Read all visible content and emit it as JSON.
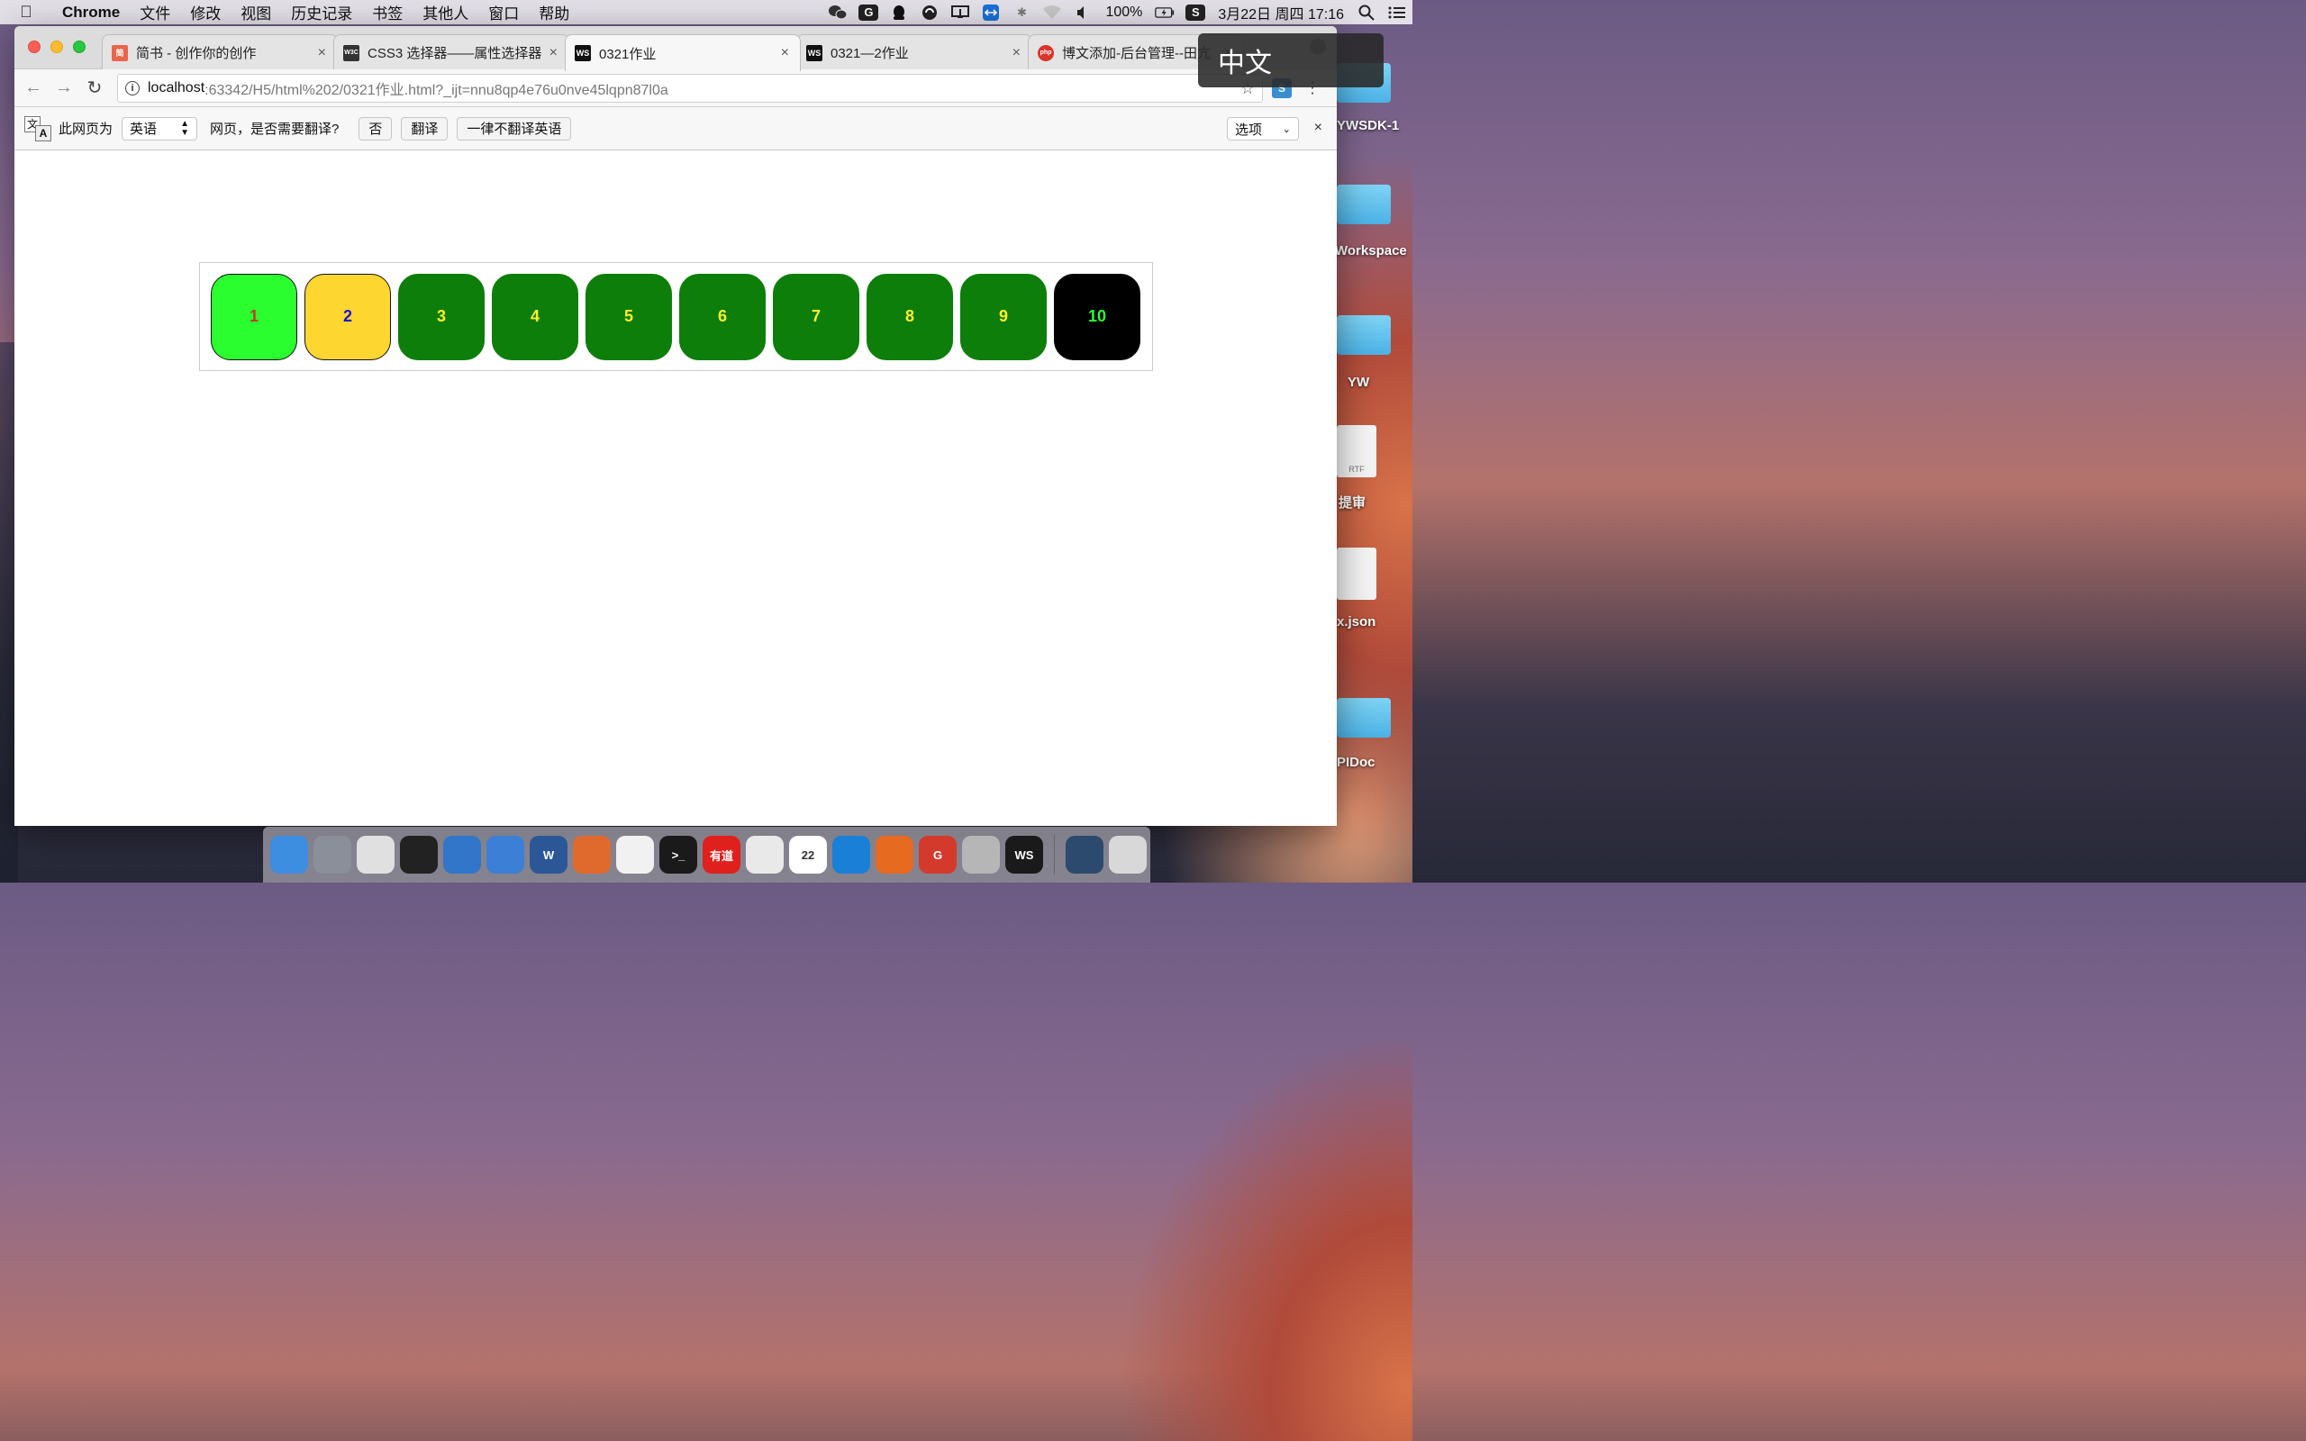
{
  "menubar": {
    "app_name": "Chrome",
    "items": [
      "文件",
      "修改",
      "视图",
      "历史记录",
      "书签",
      "其他人",
      "窗口",
      "帮助"
    ],
    "battery": "100%",
    "clock": "3月22日 周四  17:16"
  },
  "ime_badge": "中文",
  "tabs": [
    {
      "title": "简书 - 创作你的创作",
      "favicon": "简",
      "favicon_color": "#e9654b",
      "close": "×"
    },
    {
      "title": "CSS3 选择器——属性选择器",
      "favicon": "W3C",
      "favicon_color": "#333333",
      "close": "×"
    },
    {
      "title": "0321作业",
      "favicon": "WS",
      "favicon_color": "#111111",
      "close": "×",
      "active": true
    },
    {
      "title": "0321—2作业",
      "favicon": "WS",
      "favicon_color": "#111111",
      "close": "×"
    },
    {
      "title": "博文添加-后台管理--田亢",
      "favicon": "php",
      "favicon_color": "#d9352c",
      "close": "×"
    }
  ],
  "address": {
    "host": "localhost",
    "rest": ":63342/H5/html%202/0321作业.html?_ijt=nnu8qp4e76u0nve45lqpn87l0a"
  },
  "translate_bar": {
    "icon_a": "文",
    "icon_b": "A",
    "prefix": "此网页为",
    "language": "英语",
    "question": "网页，是否需要翻译?",
    "btn_no": "否",
    "btn_translate": "翻译",
    "btn_never": "一律不翻译英语",
    "options": "选项",
    "close": "×"
  },
  "balls": [
    {
      "label": "1",
      "bg": "#2afe2f",
      "color": "#c0392b",
      "border": "#111111"
    },
    {
      "label": "2",
      "bg": "#fed630",
      "color": "#1a12d6",
      "border": "#111111"
    },
    {
      "label": "3",
      "bg": "#0e7e0b",
      "color": "#ffef2a",
      "border": "#0e7e0b"
    },
    {
      "label": "4",
      "bg": "#0e7e0b",
      "color": "#ffef2a",
      "border": "#0e7e0b"
    },
    {
      "label": "5",
      "bg": "#0e7e0b",
      "color": "#ffef2a",
      "border": "#0e7e0b"
    },
    {
      "label": "6",
      "bg": "#0e7e0b",
      "color": "#ffef2a",
      "border": "#0e7e0b"
    },
    {
      "label": "7",
      "bg": "#0e7e0b",
      "color": "#ffef2a",
      "border": "#0e7e0b"
    },
    {
      "label": "8",
      "bg": "#0e7e0b",
      "color": "#ffef2a",
      "border": "#0e7e0b"
    },
    {
      "label": "9",
      "bg": "#0e7e0b",
      "color": "#ffef2a",
      "border": "#0e7e0b"
    },
    {
      "label": "10",
      "bg": "#000000",
      "color": "#2afe2f",
      "border": "#000000"
    }
  ],
  "desktop": {
    "items": [
      "YWSDK-1",
      "Workspace",
      "YW",
      "提审",
      "x.json",
      "PIDoc"
    ],
    "rtf_label": "RTF"
  },
  "dock": [
    {
      "name": "finder",
      "bg": "#3d8de0",
      "label": ""
    },
    {
      "name": "launchpad",
      "bg": "#8a8f99",
      "label": ""
    },
    {
      "name": "chrome",
      "bg": "#e0e0e0",
      "label": ""
    },
    {
      "name": "qq",
      "bg": "#222222",
      "label": ""
    },
    {
      "name": "browser",
      "bg": "#3176c8",
      "label": ""
    },
    {
      "name": "xcode",
      "bg": "#3b7fd6",
      "label": ""
    },
    {
      "name": "word",
      "bg": "#2b5797",
      "label": "W"
    },
    {
      "name": "clion",
      "bg": "#e06a2e",
      "label": ""
    },
    {
      "name": "textedit",
      "bg": "#f1f1f1",
      "label": ""
    },
    {
      "name": "terminal",
      "bg": "#1a1a1a",
      "label": ">_"
    },
    {
      "name": "youdao",
      "bg": "#e0201c",
      "label": "有道"
    },
    {
      "name": "wechat",
      "bg": "#e9e9e9",
      "label": ""
    },
    {
      "name": "calendar",
      "bg": "#ffffff",
      "label": "22"
    },
    {
      "name": "teamviewer",
      "bg": "#1a7fd6",
      "label": ""
    },
    {
      "name": "firefox",
      "bg": "#e66a1f",
      "label": ""
    },
    {
      "name": "gitee",
      "bg": "#d33a2c",
      "label": "G"
    },
    {
      "name": "keychain",
      "bg": "#b6b6b6",
      "label": ""
    },
    {
      "name": "webstorm",
      "bg": "#1a1a1a",
      "label": "WS"
    },
    {
      "name": "screen",
      "bg": "#2b4a6e",
      "label": ""
    },
    {
      "name": "trash",
      "bg": "#d8d8d8",
      "label": ""
    }
  ]
}
